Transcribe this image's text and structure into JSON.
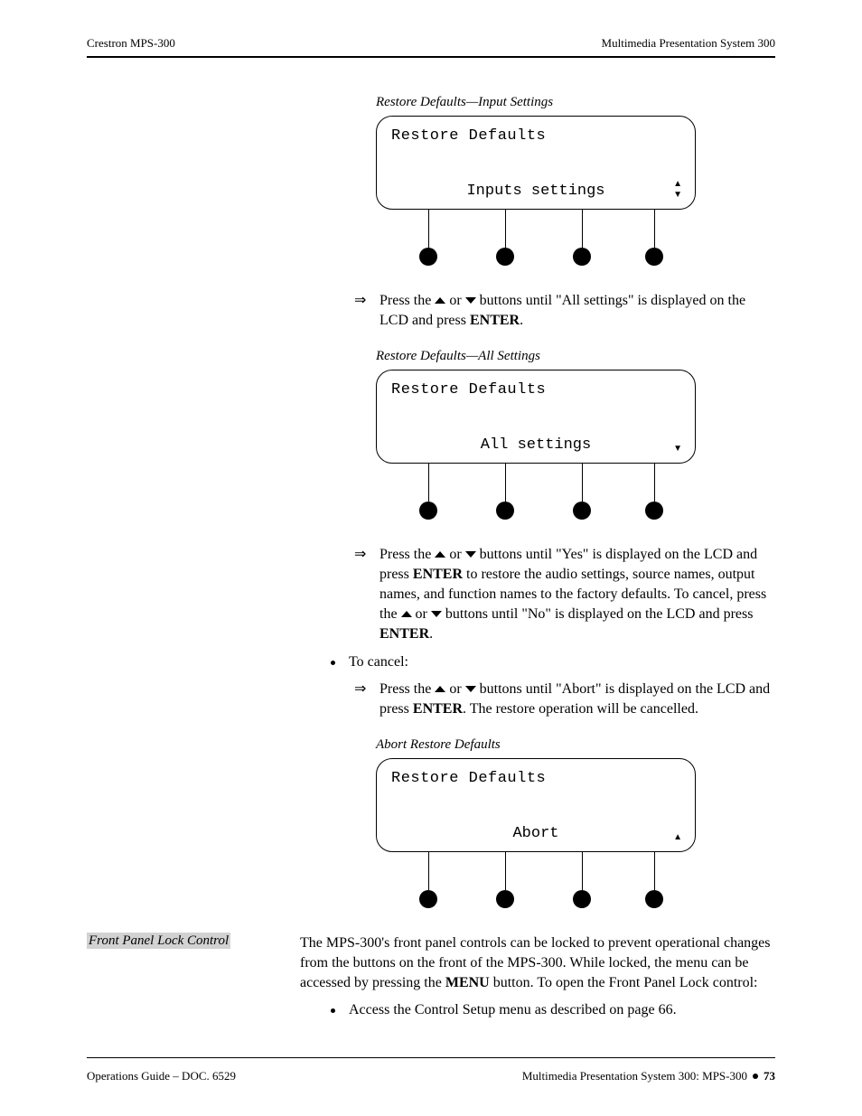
{
  "header": {
    "left": "Crestron MPS-300",
    "right": "Multimedia Presentation System 300"
  },
  "footer": {
    "left": "Operations Guide – DOC. 6529",
    "right_label": "Multimedia Presentation System 300: MPS-300",
    "page": "73"
  },
  "lcd": [
    {
      "caption": "Restore Defaults—Input Settings",
      "line1": "Restore Defaults",
      "value": "Inputs settings",
      "arrows": "both"
    },
    {
      "caption": "Restore Defaults—All Settings",
      "line1": "Restore Defaults",
      "value": "All settings",
      "arrows": "down"
    },
    {
      "caption": "Abort Restore Defaults",
      "line1": "Restore Defaults",
      "value": "Abort",
      "arrows": "up"
    }
  ],
  "steps": {
    "s1_a": "Press the ",
    "s1_b": " or ",
    "s1_c": " buttons until \"All settings\" is displayed on the LCD and press ",
    "s1_d": "ENTER",
    "s1_e": ".",
    "s2_a": "Press the ",
    "s2_b": " or ",
    "s2_c": " buttons until \"Yes\" is displayed on the LCD and press ",
    "s2_d": "ENTER",
    "s2_e": " to restore the audio settings, source names, output names, and function names to the factory defaults. To cancel, press the ",
    "s2_f": " or ",
    "s2_g": " buttons until \"No\" is displayed on the LCD and press ",
    "s2_h": "ENTER",
    "s2_i": ".",
    "cancel": "To cancel:",
    "s3_a": "Press the ",
    "s3_b": " or ",
    "s3_c": " buttons until \"Abort\" is displayed on the LCD and press ",
    "s3_d": "ENTER",
    "s3_e": ". The restore operation will be cancelled."
  },
  "section": {
    "heading": "Front Panel Lock Control",
    "para_a": "The MPS-300's front panel controls can be locked to prevent operational changes from the buttons on the front of the MPS-300. While locked, the menu can be accessed by pressing the ",
    "para_b": "MENU",
    "para_c": " button. To open the Front Panel Lock control:",
    "bullet": "Access the Control Setup menu as described on page 66."
  }
}
